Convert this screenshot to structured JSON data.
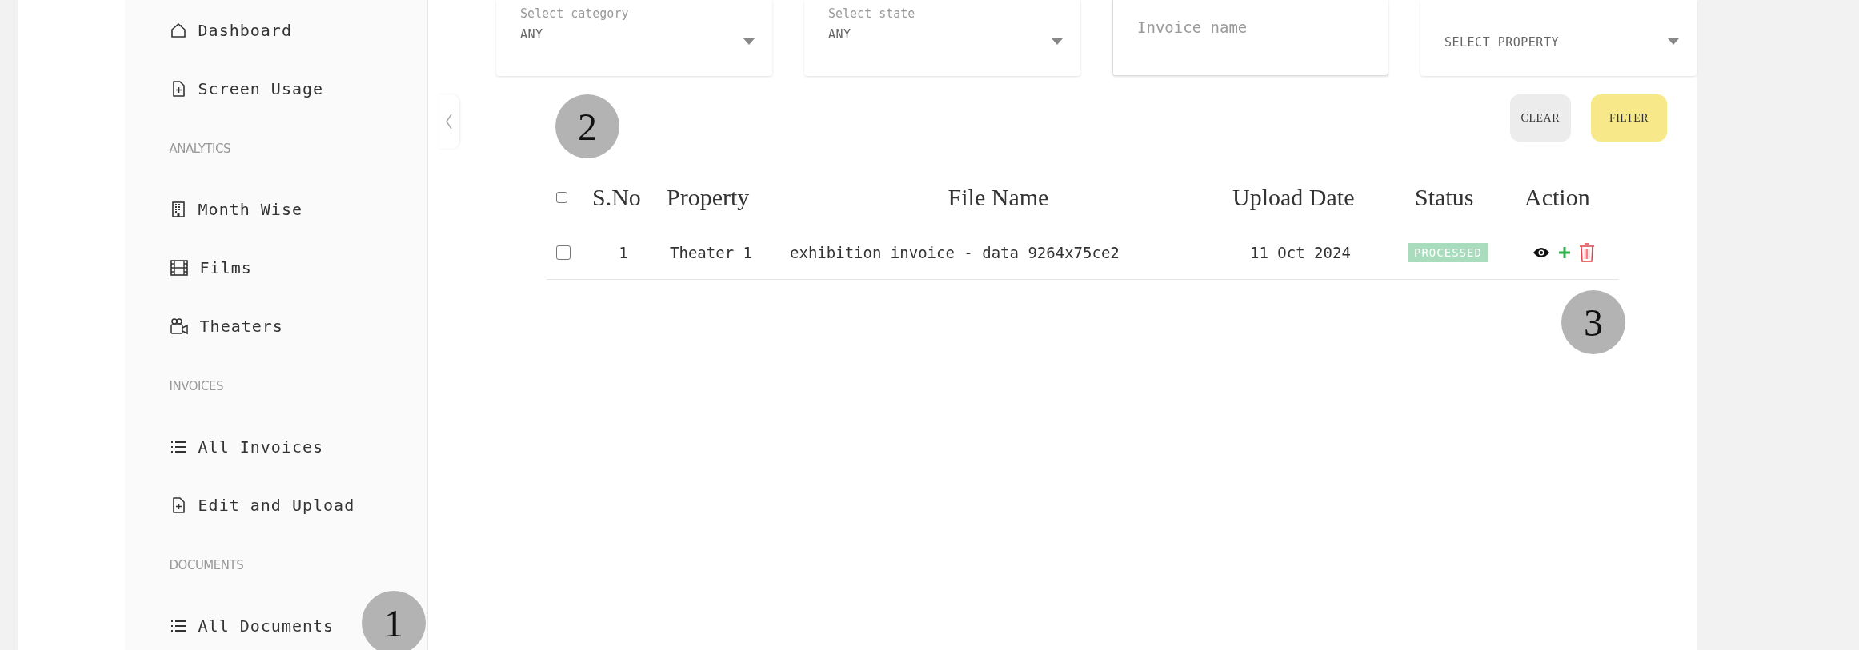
{
  "sidebar": {
    "items": [
      {
        "kind": "link",
        "label": "Dashboard"
      },
      {
        "kind": "link",
        "label": "Screen Usage"
      },
      {
        "kind": "heading",
        "label": "ANALYTICS"
      },
      {
        "kind": "link",
        "label": "Month Wise"
      },
      {
        "kind": "link",
        "label": "Films"
      },
      {
        "kind": "link",
        "label": "Theaters"
      },
      {
        "kind": "heading",
        "label": "INVOICES"
      },
      {
        "kind": "link",
        "label": "All Invoices"
      },
      {
        "kind": "link",
        "label": "Edit and Upload"
      },
      {
        "kind": "heading",
        "label": "DOCUMENTS"
      },
      {
        "kind": "link",
        "label": "All Documents"
      }
    ]
  },
  "filters": [
    {
      "kind": "select",
      "label": "Select category",
      "value": "ANY"
    },
    {
      "kind": "select",
      "label": "Select state",
      "value": "ANY"
    },
    {
      "kind": "text",
      "placeholder": "Invoice name"
    },
    {
      "kind": "select",
      "value": "SELECT PROPERTY"
    }
  ],
  "buttons": [
    {
      "kind": "secondary",
      "label": "CLEAR"
    },
    {
      "kind": "primary",
      "label": "FILTER"
    }
  ],
  "table": {
    "select_all": {
      "checked": false
    },
    "columns": [
      "S.No",
      "Property",
      "File Name",
      "Upload Date",
      "Status",
      "Action"
    ],
    "rows": [
      {
        "checked": false,
        "cells": [
          "1",
          "Theater 1",
          "exhibition invoice - data 9264x75ce2",
          "11 Oct 2024"
        ],
        "status": "PROCESSED"
      }
    ]
  },
  "callouts": [
    "1",
    "2",
    "3"
  ]
}
